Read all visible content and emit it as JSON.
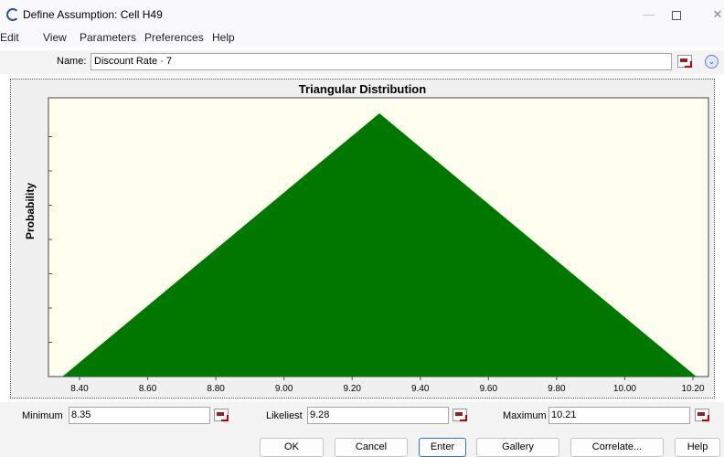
{
  "window": {
    "title": "Define Assumption: Cell H49",
    "minimize": "—",
    "close": "✕"
  },
  "menu": [
    "Edit",
    "View",
    "Parameters",
    "Preferences",
    "Help"
  ],
  "name_field": {
    "label": "Name:",
    "value": "Discount Rate · 7"
  },
  "chart_data": {
    "type": "area",
    "title": "Triangular Distribution",
    "ylabel": "Probability",
    "xlabel": "",
    "x_ticks": [
      "8.40",
      "8.60",
      "8.80",
      "9.00",
      "9.20",
      "9.40",
      "9.60",
      "9.80",
      "10.00",
      "10.20"
    ],
    "xlim": [
      8.35,
      10.21
    ],
    "series": [
      {
        "points": [
          [
            8.35,
            0
          ],
          [
            9.28,
            1
          ],
          [
            10.21,
            0
          ]
        ]
      }
    ],
    "colors": {
      "fill": "#007800",
      "plot_bg": "#fffff0"
    },
    "grid": false
  },
  "params": {
    "minimum": {
      "label": "Minimum",
      "value": "8.35"
    },
    "likeliest": {
      "label": "Likeliest",
      "value": "9.28"
    },
    "maximum": {
      "label": "Maximum",
      "value": "10.21"
    }
  },
  "buttons": {
    "ok": "OK",
    "cancel": "Cancel",
    "enter": "Enter",
    "gallery": "Gallery",
    "correlate": "Correlate...",
    "help": "Help"
  }
}
